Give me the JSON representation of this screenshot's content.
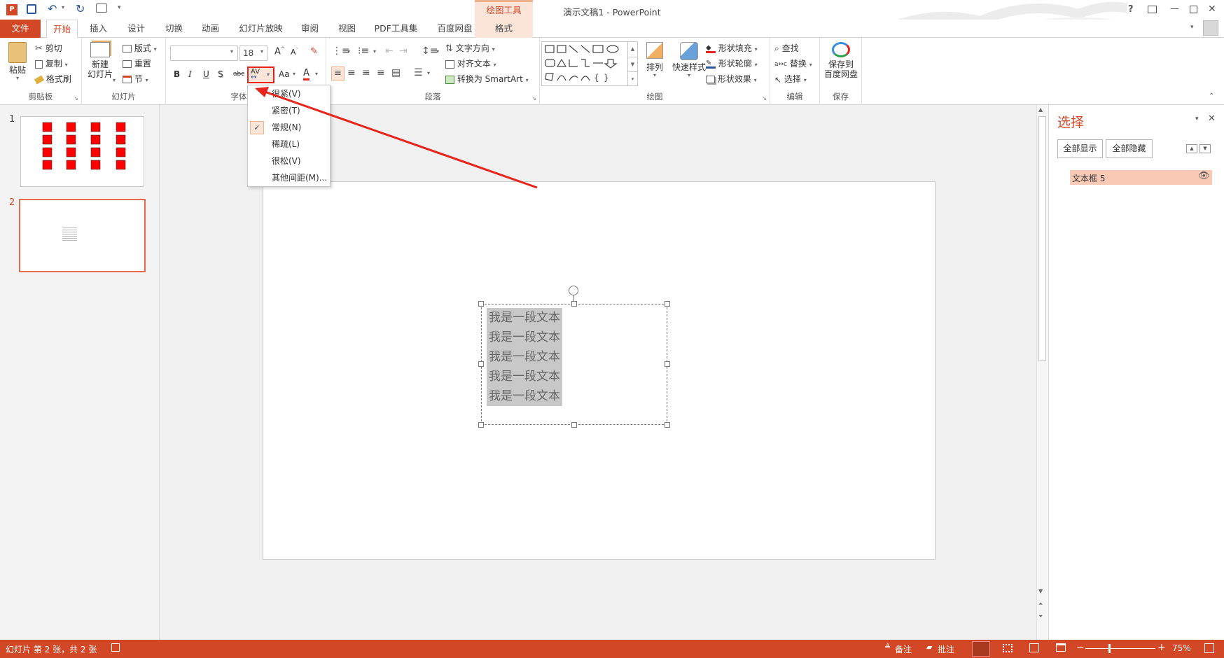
{
  "app": {
    "title": "演示文稿1 - PowerPoint",
    "contextual_tab_group": "绘图工具"
  },
  "window_controls": {
    "help": "?",
    "restore": "□",
    "minimize": "—",
    "close": "✕"
  },
  "tabs": [
    "文件",
    "开始",
    "插入",
    "设计",
    "切换",
    "动画",
    "幻灯片放映",
    "审阅",
    "视图",
    "PDF工具集",
    "百度网盘",
    "格式"
  ],
  "active_tab": "开始",
  "clipboard": {
    "paste": "粘贴",
    "cut": "剪切",
    "copy": "复制",
    "format_painter": "格式刷",
    "label": "剪贴板"
  },
  "slides_group": {
    "new_slide_1": "新建",
    "new_slide_2": "幻灯片",
    "layout": "版式",
    "reset": "重置",
    "section": "节",
    "label": "幻灯片"
  },
  "font_group": {
    "font_name": "",
    "font_size": "18",
    "bold": "B",
    "italic": "I",
    "underline": "U",
    "shadow": "S",
    "strike": "abc",
    "spacing": "AV",
    "case": "Aa",
    "color": "A",
    "label": "字体"
  },
  "paragraph_group": {
    "text_direction": "文字方向",
    "align_text": "对齐文本",
    "convert_smartart": "转换为 SmartArt",
    "label": "段落"
  },
  "drawing_group": {
    "arrange": "排列",
    "quick_styles": "快速样式",
    "shape_fill": "形状填充",
    "shape_outline": "形状轮廓",
    "shape_effects": "形状效果",
    "label": "绘图"
  },
  "editing_group": {
    "find": "查找",
    "replace": "替换",
    "select": "选择",
    "label": "编辑"
  },
  "save_group": {
    "save_1": "保存到",
    "save_2": "百度网盘",
    "label": "保存"
  },
  "spacing_menu": {
    "items": [
      {
        "label": "很紧(V)",
        "checked": false
      },
      {
        "label": "紧密(T)",
        "checked": false
      },
      {
        "label": "常规(N)",
        "checked": true
      },
      {
        "label": "稀疏(L)",
        "checked": false
      },
      {
        "label": "很松(V)",
        "checked": false
      },
      {
        "label": "其他间距(M)...",
        "checked": false
      }
    ]
  },
  "thumbnails": [
    {
      "number": "1",
      "selected": false
    },
    {
      "number": "2",
      "selected": true
    }
  ],
  "slide": {
    "text_lines": [
      "我是一段文本",
      "我是一段文本",
      "我是一段文本",
      "我是一段文本",
      "我是一段文本"
    ]
  },
  "selection_pane": {
    "title": "选择",
    "show_all": "全部显示",
    "hide_all": "全部隐藏",
    "items": [
      {
        "name": "文本框 5"
      }
    ]
  },
  "status": {
    "slide_info": "幻灯片 第 2 张，共 2 张",
    "notes": "备注",
    "comments": "批注",
    "zoom": "75%"
  },
  "colors": {
    "accent": "#d24726",
    "highlight_box": "#e8251c",
    "selection_item": "#f9c9b5"
  }
}
